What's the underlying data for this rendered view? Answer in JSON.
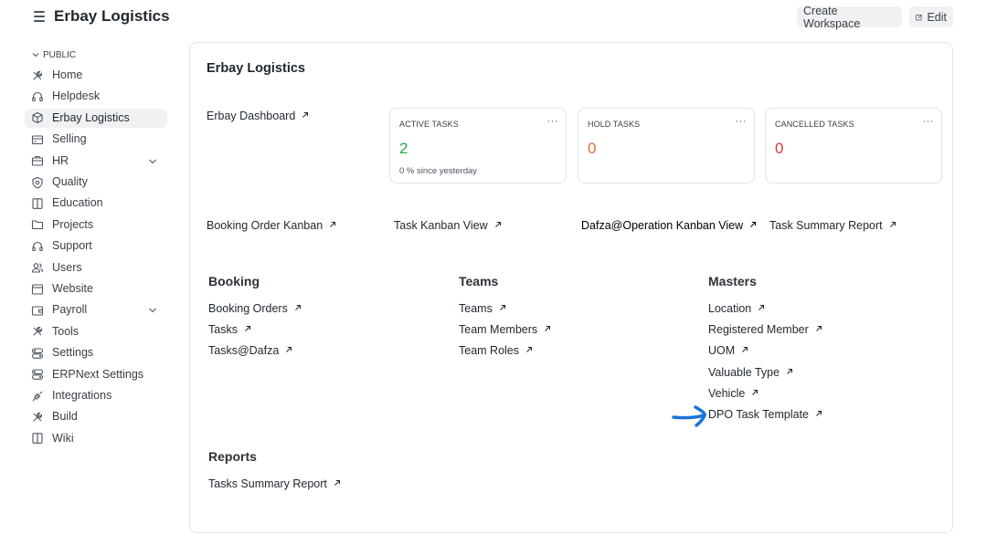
{
  "header": {
    "title": "Erbay Logistics",
    "create_workspace": "Create Workspace",
    "edit": "Edit"
  },
  "sidebar": {
    "section": "PUBLIC",
    "items": [
      {
        "label": "Home",
        "icon": "tools-icon"
      },
      {
        "label": "Helpdesk",
        "icon": "headset-icon"
      },
      {
        "label": "Erbay Logistics",
        "icon": "cube-icon",
        "active": true
      },
      {
        "label": "Selling",
        "icon": "card-icon"
      },
      {
        "label": "HR",
        "icon": "briefcase-icon",
        "expandable": true
      },
      {
        "label": "Quality",
        "icon": "shield-icon"
      },
      {
        "label": "Education",
        "icon": "book-icon"
      },
      {
        "label": "Projects",
        "icon": "folder-icon"
      },
      {
        "label": "Support",
        "icon": "headset-icon"
      },
      {
        "label": "Users",
        "icon": "users-icon"
      },
      {
        "label": "Website",
        "icon": "browser-icon"
      },
      {
        "label": "Payroll",
        "icon": "wallet-icon",
        "expandable": true
      },
      {
        "label": "Tools",
        "icon": "tools-icon"
      },
      {
        "label": "Settings",
        "icon": "settings-icon"
      },
      {
        "label": "ERPNext Settings",
        "icon": "settings-icon"
      },
      {
        "label": "Integrations",
        "icon": "plug-icon"
      },
      {
        "label": "Build",
        "icon": "tools-icon"
      },
      {
        "label": "Wiki",
        "icon": "book-icon"
      }
    ]
  },
  "main": {
    "title": "Erbay Logistics",
    "dashboard_link": "Erbay Dashboard",
    "cards": [
      {
        "label": "ACTIVE TASKS",
        "value": "2",
        "color": "#28a745",
        "sub": "0 % since yesterday"
      },
      {
        "label": "HOLD TASKS",
        "value": "0",
        "color": "#e86c2c",
        "sub": ""
      },
      {
        "label": "CANCELLED TASKS",
        "value": "0",
        "color": "#e03636",
        "sub": ""
      }
    ],
    "shortcuts": [
      "Booking Order Kanban",
      "Task Kanban View",
      "Dafza@Operation Kanban View",
      "Task Summary Report"
    ],
    "groups": {
      "booking": {
        "title": "Booking",
        "links": [
          "Booking Orders",
          "Tasks",
          "Tasks@Dafza"
        ]
      },
      "teams": {
        "title": "Teams",
        "links": [
          "Teams",
          "Team Members",
          "Team Roles"
        ]
      },
      "masters": {
        "title": "Masters",
        "links": [
          "Location",
          "Registered Member",
          "UOM",
          "Valuable Type",
          "Vehicle",
          "DPO Task Template"
        ]
      },
      "reports": {
        "title": "Reports",
        "links": [
          "Tasks Summary Report"
        ]
      }
    }
  },
  "colors": {
    "annotation_arrow": "#1a73d9"
  }
}
